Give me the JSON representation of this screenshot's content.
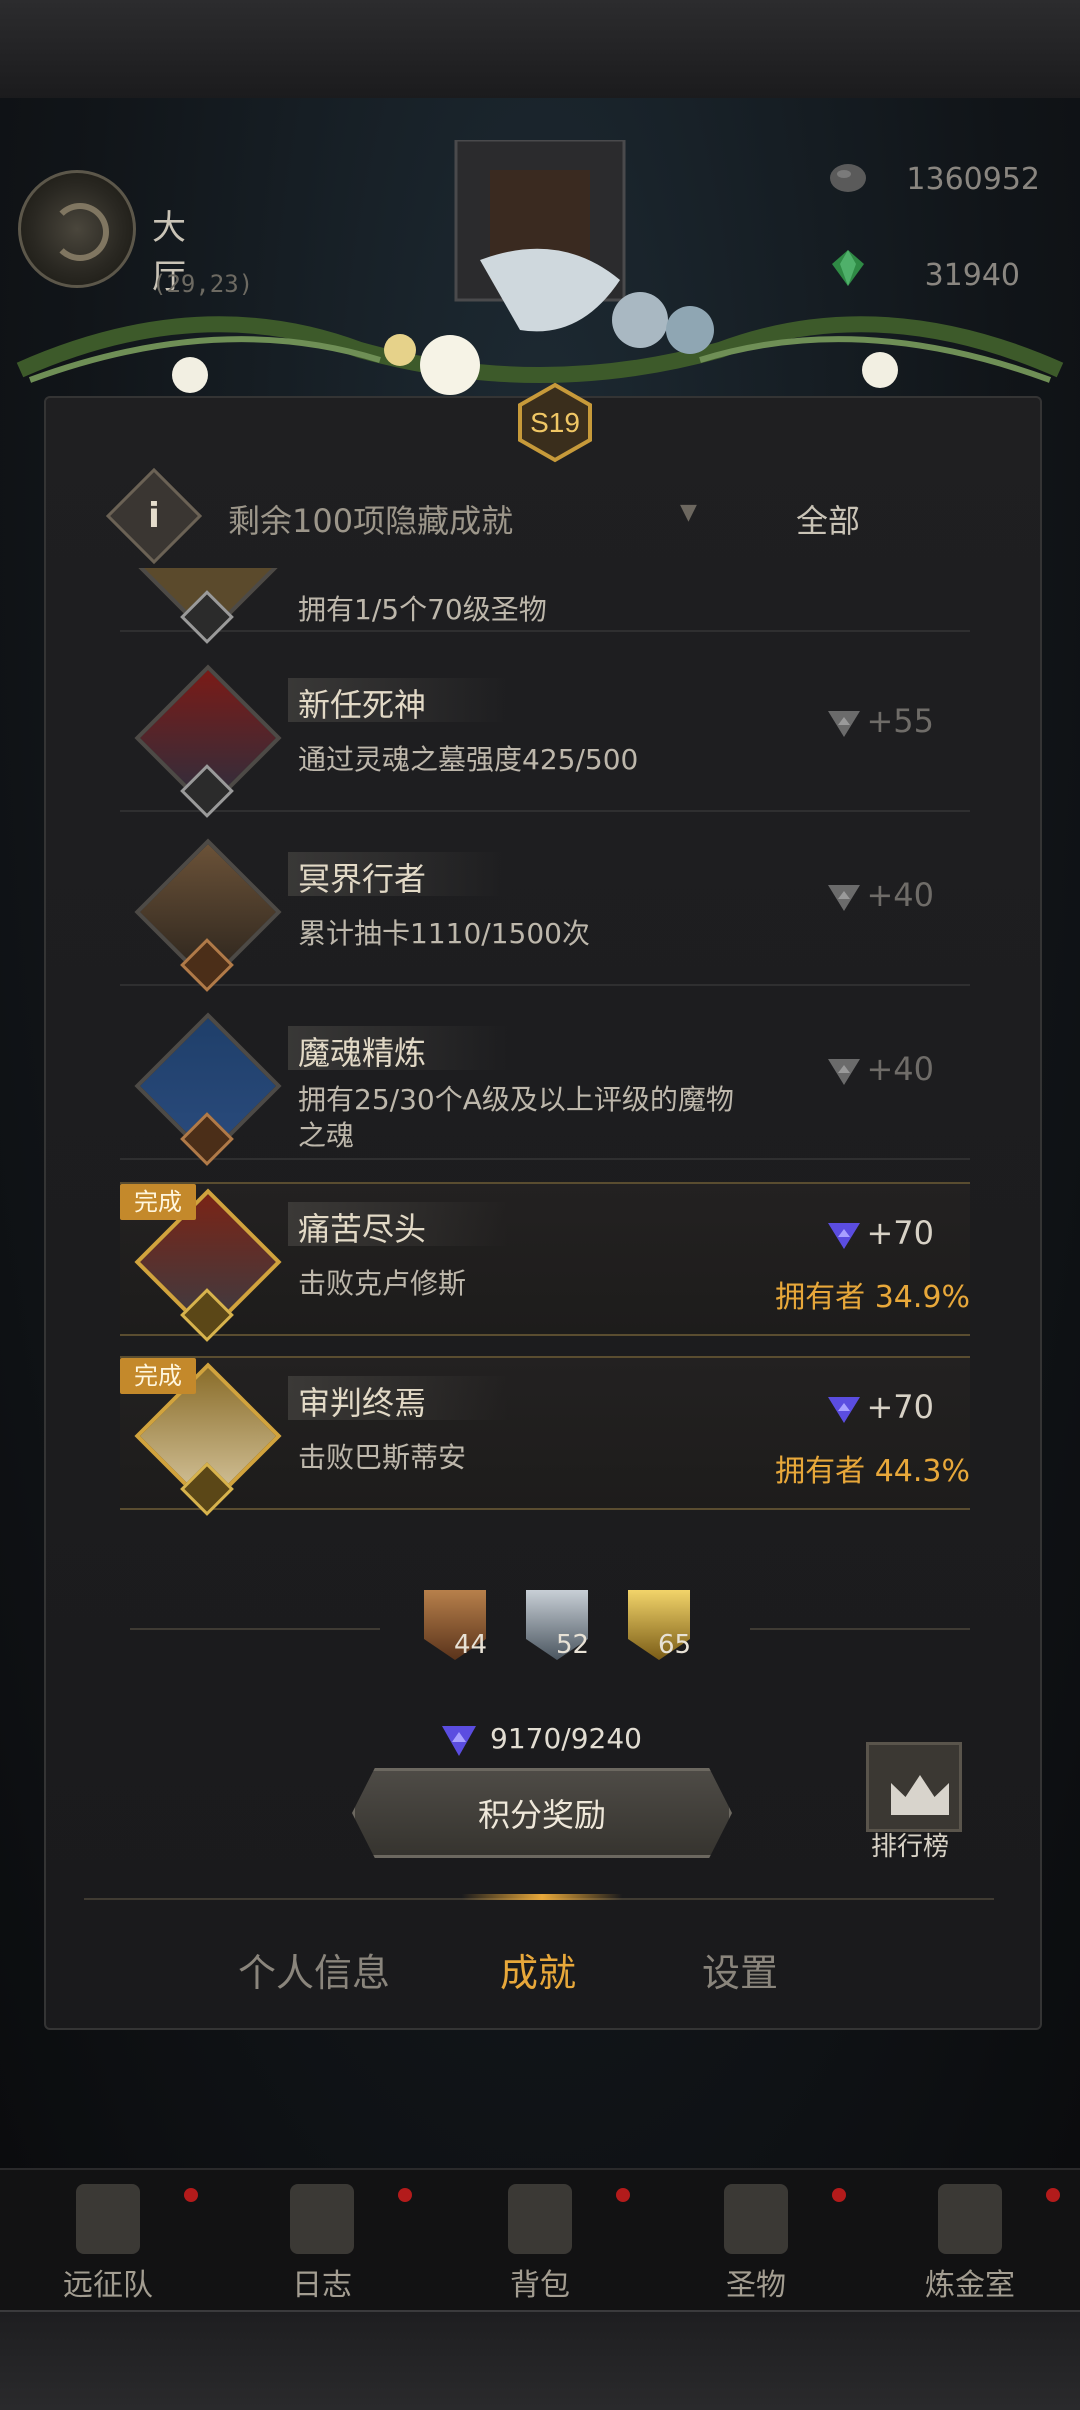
{
  "hall": {
    "name": "大厅",
    "coords": "(29,23)"
  },
  "resources": {
    "stones": "1360952",
    "gems": "31940"
  },
  "season": {
    "badge": "S19"
  },
  "filter": {
    "hidden_text": "剩余100项隐藏成就",
    "scope": "全部"
  },
  "achievements": [
    {
      "title": "",
      "desc": "拥有1/5个70级圣物",
      "points": "",
      "owner": "",
      "done": false,
      "tier": "silver"
    },
    {
      "title": "新任死神",
      "desc": "通过灵魂之墓强度425/500",
      "points": "+55",
      "owner": "",
      "done": false,
      "tier": "silver"
    },
    {
      "title": "冥界行者",
      "desc": "累计抽卡1110/1500次",
      "points": "+40",
      "owner": "",
      "done": false,
      "tier": "bronze"
    },
    {
      "title": "魔魂精炼",
      "desc": "拥有25/30个A级及以上评级的魔物之魂",
      "points": "+40",
      "owner": "",
      "done": false,
      "tier": "bronze"
    },
    {
      "title": "痛苦尽头",
      "desc": "击败克卢修斯",
      "points": "+70",
      "owner": "拥有者 34.9%",
      "done": true,
      "done_label": "完成",
      "tier": "gold"
    },
    {
      "title": "审判终焉",
      "desc": "击败巴斯蒂安",
      "points": "+70",
      "owner": "拥有者 44.3%",
      "done": true,
      "done_label": "完成",
      "tier": "gold"
    }
  ],
  "tier_summary": {
    "bronze": "44",
    "silver": "52",
    "gold": "65"
  },
  "score": "9170/9240",
  "reward_button": "积分奖励",
  "ranking_button": "排行榜",
  "tabs": {
    "profile": "个人信息",
    "achievements": "成就",
    "settings": "设置"
  },
  "nav": {
    "expedition": "远征队",
    "log": "日志",
    "bag": "背包",
    "relic": "圣物",
    "alchemy": "炼金室"
  },
  "colors": {
    "accent": "#e8a83a",
    "done_tag": "#c4892b",
    "points_icon": "#6a5cff"
  }
}
